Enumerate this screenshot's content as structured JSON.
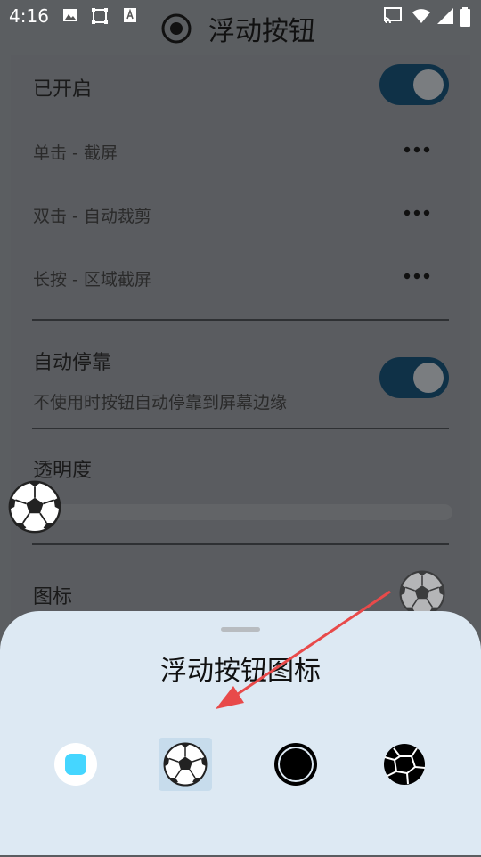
{
  "status_bar": {
    "time": "4:16"
  },
  "header": {
    "title": "浮动按钮"
  },
  "settings": {
    "enabled_label": "已开启",
    "actions": [
      {
        "label": "单击 - 截屏"
      },
      {
        "label": "双击 - 自动裁剪"
      },
      {
        "label": "长按 - 区域截屏"
      }
    ],
    "auto_dock": {
      "title": "自动停靠",
      "subtitle": "不使用时按钮自动停靠到屏幕边缘"
    },
    "opacity": {
      "title": "透明度",
      "value_percent": 0
    },
    "icon": {
      "title": "图标"
    }
  },
  "sheet": {
    "title": "浮动按钮图标",
    "options": [
      {
        "name": "cyan-square-icon"
      },
      {
        "name": "soccer-ball-icon",
        "selected": true
      },
      {
        "name": "black-circle-icon"
      },
      {
        "name": "camera-aperture-icon"
      }
    ]
  },
  "colors": {
    "accent": "#0f3147",
    "sheet_bg": "#dde9f3",
    "arrow": "#e84a4a"
  }
}
